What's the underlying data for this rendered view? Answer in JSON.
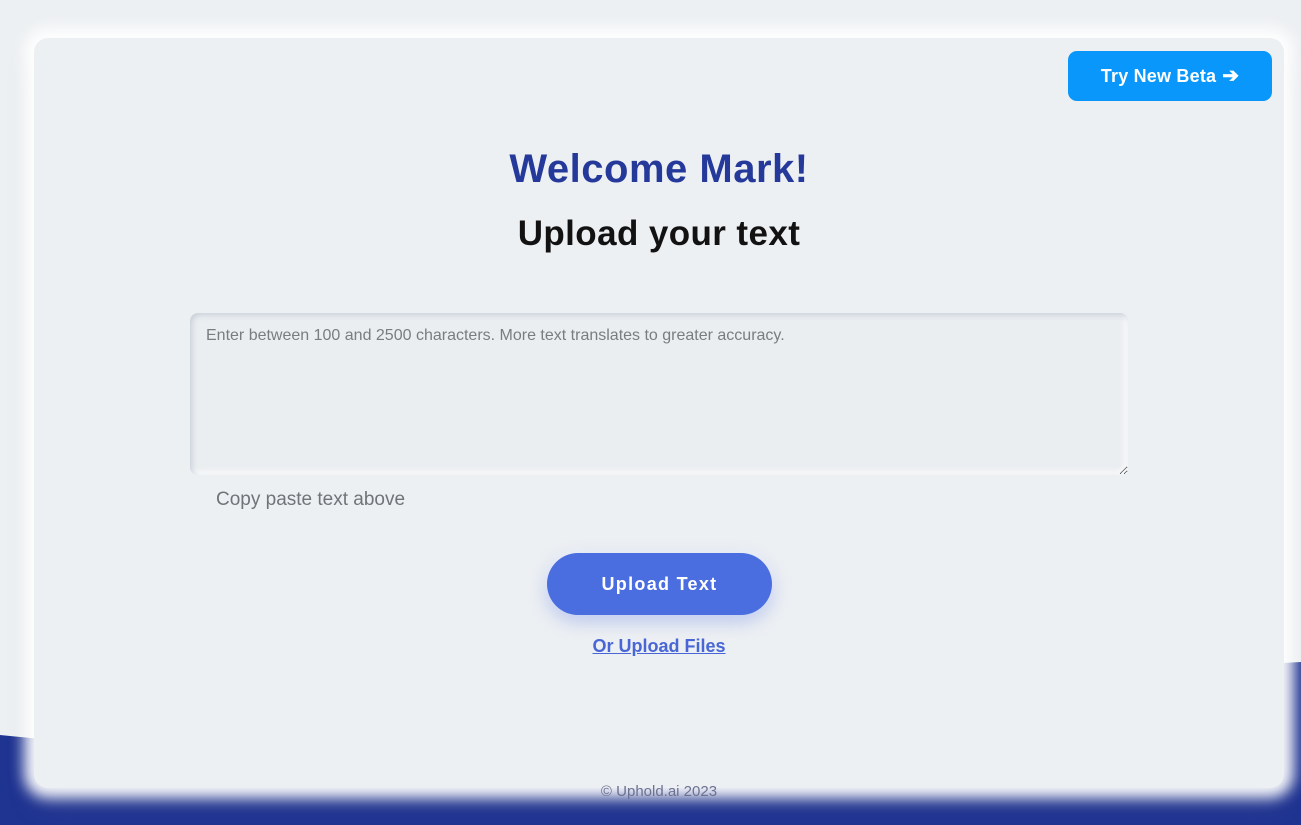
{
  "header": {
    "beta_label": "Try New Beta",
    "beta_icon": "arrow-right-icon"
  },
  "main": {
    "welcome": "Welcome Mark!",
    "title": "Upload your text",
    "textarea": {
      "value": "",
      "placeholder": "Enter between 100 and 2500 characters. More text translates to greater accuracy."
    },
    "helper": "Copy paste text above",
    "upload_label": "Upload Text",
    "files_link": "Or Upload Files"
  },
  "footer": {
    "copyright": "© Uphold.ai 2023"
  },
  "colors": {
    "brand_dark": "#25399a",
    "accent": "#0997fb",
    "button": "#4a6ee0",
    "link": "#4866d6",
    "wave": "#1f3391"
  }
}
